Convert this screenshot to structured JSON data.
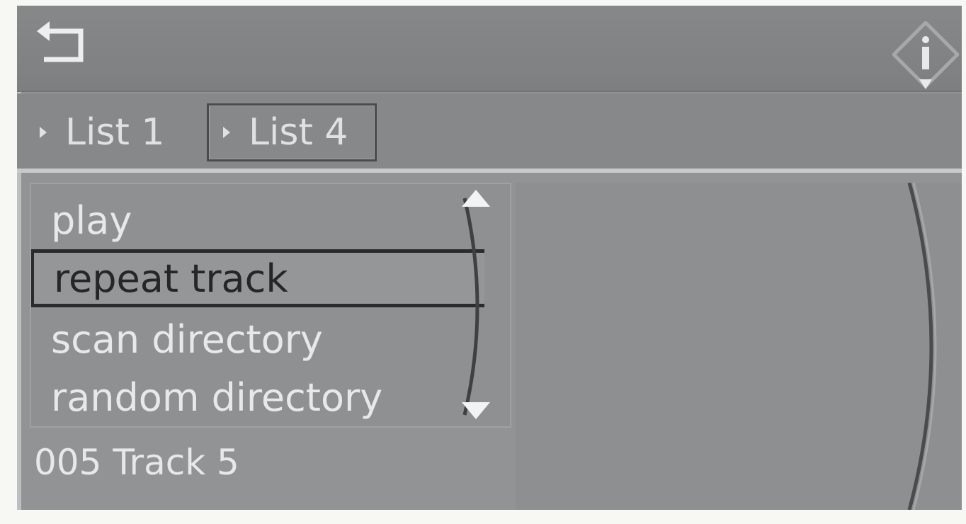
{
  "header": {
    "back_icon": "back-arrow-icon",
    "info_icon": "info-icon"
  },
  "tabs": [
    {
      "label": "List 1",
      "selected": false
    },
    {
      "label": "List 4",
      "selected": true
    }
  ],
  "menu": {
    "items": [
      {
        "label": "play",
        "selected": false
      },
      {
        "label": "repeat track",
        "selected": true
      },
      {
        "label": "scan directory",
        "selected": false
      },
      {
        "label": "random directory",
        "selected": false
      }
    ]
  },
  "status": {
    "track": "005 Track  5"
  },
  "colors": {
    "background": "#929394",
    "text": "#e6e8ea",
    "selected_text": "#252628"
  }
}
